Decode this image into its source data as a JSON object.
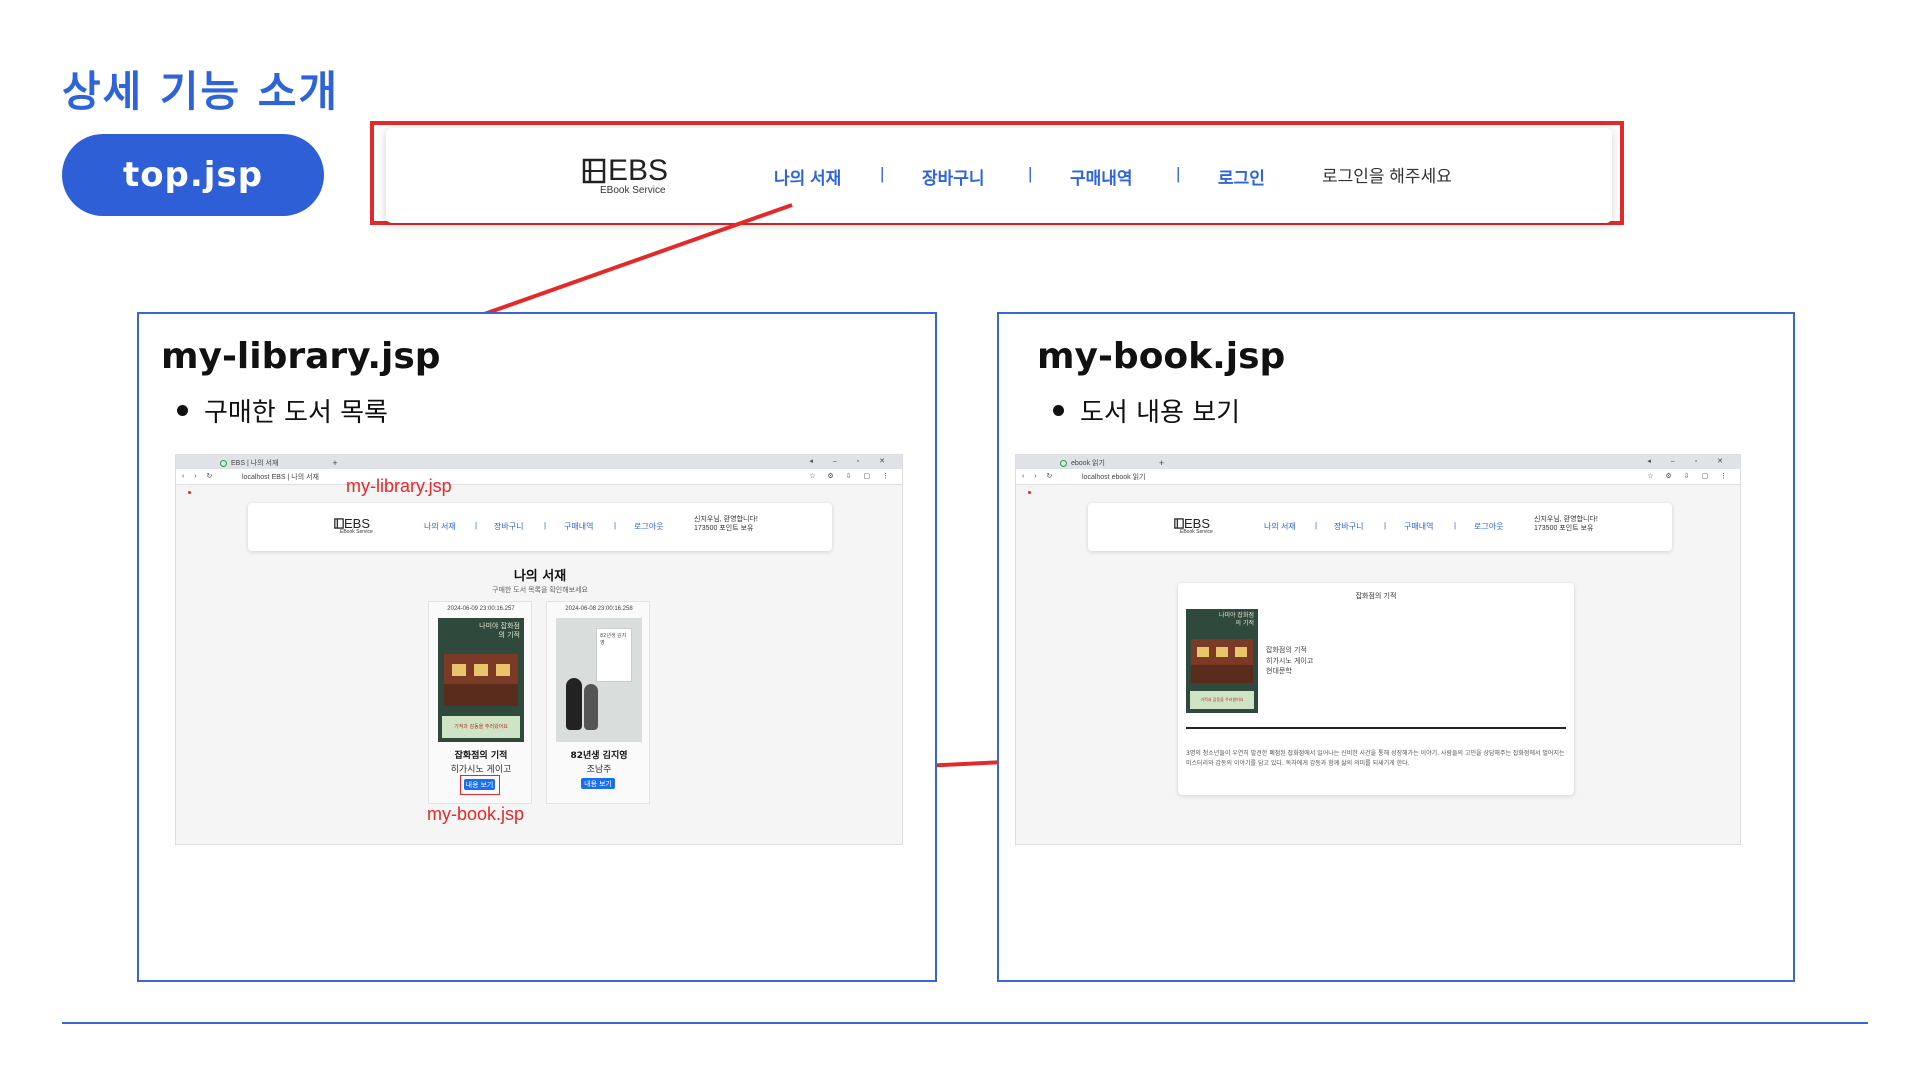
{
  "slide": {
    "title": "상세 기능 소개",
    "pill_label": "top.jsp"
  },
  "top_nav": {
    "logo_main": "EBS",
    "logo_sub": "EBook Service",
    "links": [
      "나의 서재",
      "장바구니",
      "구매내역",
      "로그인"
    ],
    "separator": "|",
    "login_prompt": "로그인을 해주세요"
  },
  "left_panel": {
    "title": "my-library.jsp",
    "bullet": "구매한 도서 목록",
    "red_label_top": "my-library.jsp",
    "red_label_bottom": "my-book.jsp",
    "browser": {
      "tab_title": "EBS | 나의 서재",
      "address": "localhost EBS | 나의 서재"
    },
    "nav": {
      "logo_main": "EBS",
      "logo_sub": "EBook Service",
      "links": [
        "나의 서재",
        "장바구니",
        "구매내역",
        "로그아웃"
      ],
      "separator": "|",
      "welcome": "신지우님, 환영합니다!",
      "points": "173500 포인트 보유"
    },
    "heading": "나의 서재",
    "subheading": "구매한 도서 목록을 확인해보세요",
    "books": [
      {
        "date": "2024-06-09 23:00:16.257",
        "title": "잡화점의 기적",
        "author": "히가시노 게이고",
        "button": "내용 보기",
        "cover_title": "나미야 잡화점의 기적",
        "cover_band": "기적과 감동을 주러왔어요"
      },
      {
        "date": "2024-06-08 23:00:16.258",
        "title": "82년생 김지영",
        "author": "조남주",
        "button": "내용 보기",
        "cover_title": "82년생 김지영"
      }
    ]
  },
  "right_panel": {
    "title": "my-book.jsp",
    "bullet": "도서 내용 보기",
    "browser": {
      "tab_title": "ebook 읽기",
      "address": "localhost ebook 읽기"
    },
    "nav": {
      "logo_main": "EBS",
      "logo_sub": "EBook Service",
      "links": [
        "나의 서재",
        "장바구니",
        "구매내역",
        "로그아웃"
      ],
      "separator": "|",
      "welcome": "신지우님, 환영합니다!",
      "points": "173500 포인트 보유"
    },
    "book": {
      "header": "잡화점의 기적",
      "title": "잡화점의 기적",
      "author": "히가시노 게이고",
      "genre": "현대문학",
      "cover_title": "나미야 잡화점의 기적",
      "cover_band": "기적과 감동을 주러왔어요",
      "description": "3명의 청소년들이 우연히 발견한 폐점된 잡화점에서 일어나는 신비한 사건을 통해 성장해가는 이야기. 사람들의 고민을 상담해주는 잡화점에서 벌어지는 미스터리와 감동의 이야기를 담고 있다. 독자에게 감동과 함께 삶의 의미를 되새기게 한다."
    }
  },
  "colors": {
    "accent_blue": "#2f64d9",
    "highlight_red": "#e32a2a",
    "panel_border": "#3a66d4"
  }
}
